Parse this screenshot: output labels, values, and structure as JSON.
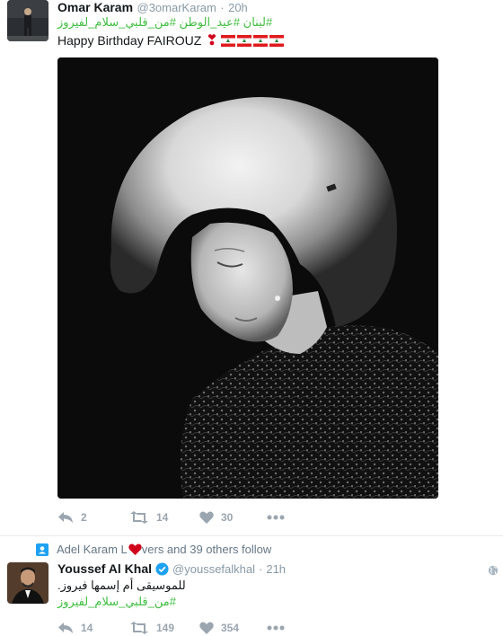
{
  "tweet1": {
    "name": "Omar Karam",
    "handle": "@3omarKaram",
    "dot": "·",
    "time": "20h",
    "hashtags": "#لبنان #عيد_الوطن #من_قلبي_سلام_لفيروز",
    "text": "Happy Birthday FAIROUZ",
    "emoji": "❣",
    "actions": {
      "reply_count": "2",
      "retweet_count": "14",
      "like_count": "30"
    }
  },
  "context": {
    "text_before": "Adel Karam L",
    "text_after": "vers and 39 others follow"
  },
  "tweet2": {
    "name": "Youssef Al Khal",
    "handle": "@youssefalkhal",
    "dot": "·",
    "time": "21h",
    "line1": "للموسيقى أم إسمها فيروز.",
    "line2": "#من_قلبي_سلام_لفيروز",
    "actions": {
      "reply_count": "14",
      "retweet_count": "149",
      "like_count": "354"
    }
  },
  "colors": {
    "hashtag_green": "#3fbf3f",
    "icon_gray": "#9aa5af",
    "verified_blue": "#1da1f2",
    "heart_red": "#d0021b",
    "flag_red": "#e0191b"
  },
  "icons": [
    "reply-icon",
    "retweet-icon",
    "like-icon",
    "more-icon",
    "verified-icon",
    "globe-icon",
    "follow-context-icon",
    "heart-icon",
    "lebanon-flag-icon"
  ]
}
